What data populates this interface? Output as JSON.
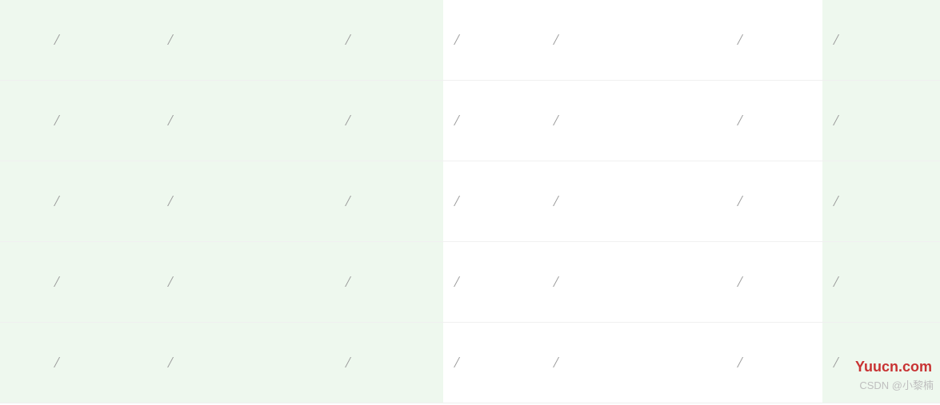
{
  "table": {
    "rows": [
      {
        "cells": [
          "",
          "/",
          "/",
          "/",
          "/",
          "/",
          "/",
          "/"
        ]
      },
      {
        "cells": [
          "",
          "/",
          "/",
          "/",
          "/",
          "/",
          "/",
          "/"
        ]
      },
      {
        "cells": [
          "",
          "/",
          "/",
          "/",
          "/",
          "/",
          "/",
          "/"
        ]
      },
      {
        "cells": [
          "",
          "/",
          "/",
          "/",
          "/",
          "/",
          "/",
          "/"
        ]
      },
      {
        "cells": [
          "",
          "/",
          "/",
          "/",
          "/",
          "/",
          "/",
          "/"
        ]
      }
    ]
  },
  "watermark": {
    "site": "Yuucn.com",
    "author": "CSDN @小黎楠"
  }
}
